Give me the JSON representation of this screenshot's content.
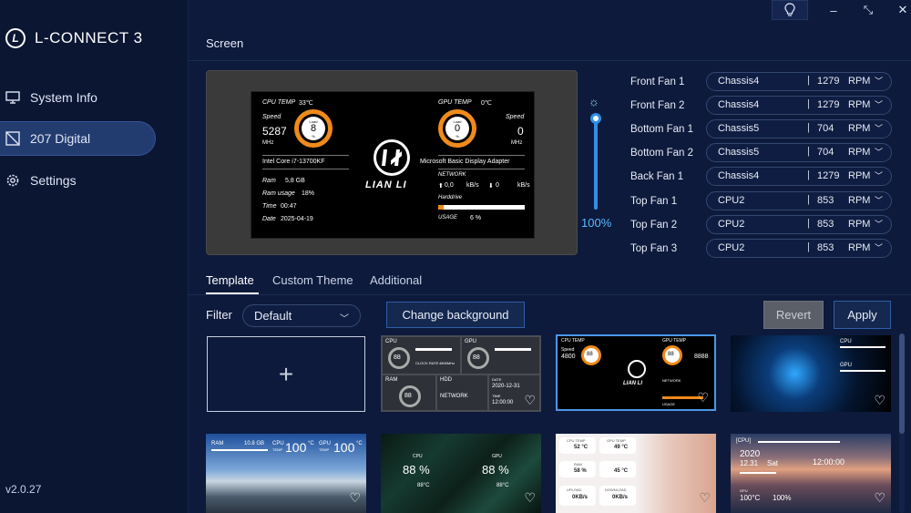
{
  "app": {
    "name": "L-CONNECT 3",
    "logo_glyph": "L",
    "version": "v2.0.27"
  },
  "sidebar": {
    "items": [
      {
        "label": "System Info",
        "icon": "monitor-icon"
      },
      {
        "label": "207 Digital",
        "icon": "display-icon",
        "active": true
      },
      {
        "label": "Settings",
        "icon": "gear-icon"
      }
    ]
  },
  "titlebar": {
    "bulb": "lightbulb-icon",
    "minimize": "–",
    "restore": "⤡",
    "close": "✕"
  },
  "screen": {
    "title": "Screen",
    "lcd": {
      "cpu_temp_label": "CPU TEMP",
      "cpu_temp": "33℃",
      "speed_label": "Speed",
      "cpu_speed": "5287",
      "cpu_speed_unit": "MHz",
      "load_label": "Load",
      "cpu_load": "8",
      "pct": "%",
      "cpu_name": "Intel Core i7-13700KF",
      "ram_label": "Ram",
      "ram": "5,8 GB",
      "ram_usage_label": "Ram usage",
      "ram_usage": "18%",
      "time_label": "Time",
      "time": "00:47",
      "date_label": "Date",
      "date": "2025-04-19",
      "gpu_temp_label": "GPU TEMP",
      "gpu_temp": "0℃",
      "gpu_load": "0",
      "gpu_speed": "0",
      "gpu_speed_unit": "MHz",
      "gpu_name": "Microsoft Basic Display Adapter",
      "network_label": "NETWORK",
      "net_up": "0,0",
      "net_up_unit": "kB/s",
      "net_down": "0",
      "net_down_unit": "kB/s",
      "harddrive_label": "Harddrive",
      "usage_label": "USAGE",
      "usage": "6 %",
      "usage_fraction": 0.06,
      "brand": "LIAN LI"
    }
  },
  "brightness": {
    "value": "100%",
    "fraction": 1.0
  },
  "fans": [
    {
      "label": "Front Fan 1",
      "source": "Chassis4",
      "rpm": "1279",
      "unit": "RPM"
    },
    {
      "label": "Front Fan 2",
      "source": "Chassis4",
      "rpm": "1279",
      "unit": "RPM"
    },
    {
      "label": "Bottom Fan 1",
      "source": "Chassis5",
      "rpm": "704",
      "unit": "RPM"
    },
    {
      "label": "Bottom Fan 2",
      "source": "Chassis5",
      "rpm": "704",
      "unit": "RPM"
    },
    {
      "label": "Back Fan 1",
      "source": "Chassis4",
      "rpm": "1279",
      "unit": "RPM"
    },
    {
      "label": "Top Fan 1",
      "source": "CPU2",
      "rpm": "853",
      "unit": "RPM"
    },
    {
      "label": "Top Fan 2",
      "source": "CPU2",
      "rpm": "853",
      "unit": "RPM"
    },
    {
      "label": "Top Fan 3",
      "source": "CPU2",
      "rpm": "853",
      "unit": "RPM"
    }
  ],
  "tabs": [
    {
      "label": "Template",
      "active": true
    },
    {
      "label": "Custom Theme"
    },
    {
      "label": "Additional"
    }
  ],
  "toolbar": {
    "filter_label": "Filter",
    "filter_value": "Default",
    "change_background": "Change background",
    "revert": "Revert",
    "apply": "Apply"
  },
  "templates": {
    "add_glyph": "+",
    "t2": {
      "cpu": "CPU",
      "gpu": "GPU",
      "ram": "RAM",
      "hdd": "HDD",
      "network": "NETWORK",
      "date_lbl": "DATE",
      "date": "2020-12-31",
      "time_lbl": "TIME",
      "time": "12:00:00",
      "v88": "88",
      "clock": "CLOCK RATE",
      "clock_val": "4800MHz"
    },
    "t3": {
      "cpu_temp": "CPU TEMP",
      "gpu_temp": "GPU TEMP",
      "speed": "Speed",
      "v4800": "4800",
      "v8888": "8888",
      "v88": "88",
      "brand": "LIAN LI",
      "network": "NETWORK",
      "usage": "USAGE"
    },
    "t4": {
      "cpu": "CPU",
      "gpu": "GPU"
    },
    "t5": {
      "ram": "RAM",
      "ram_val": "10.8 GB",
      "cpu": "CPU",
      "cpu_val": "100",
      "gpu": "GPU",
      "gpu_val": "100",
      "deg": "°C",
      "temp": "TEMP"
    },
    "t6": {
      "cpu": "CPU",
      "gpu": "GPU",
      "cpu_pct": "88 %",
      "gpu_pct": "88 %",
      "cpu_temp": "88°C",
      "gpu_temp": "88°C"
    },
    "t7": {
      "cpu_temp": "CPU TEMP",
      "gpu_temp": "GPU TEMP",
      "c52": "52 °C",
      "c49": "49 °C",
      "ram": "RAM",
      "p58": "58 %",
      "c45": "45 °C",
      "upload": "UPLOAD",
      "download": "DOWNLOAD",
      "up": "0KB/s",
      "down": "0KB/s"
    },
    "t8": {
      "cpu": "[CPU]",
      "gpu": "GPU",
      "year": "2020",
      "date": "12.31",
      "day": "Sat",
      "time": "12:00:00",
      "c100": "100°C",
      "p100": "100%"
    }
  },
  "colors": {
    "accent": "#2f8fe6",
    "orange": "#f08a1a",
    "bg": "#0d1a3c",
    "sidebar": "#0b1633"
  }
}
